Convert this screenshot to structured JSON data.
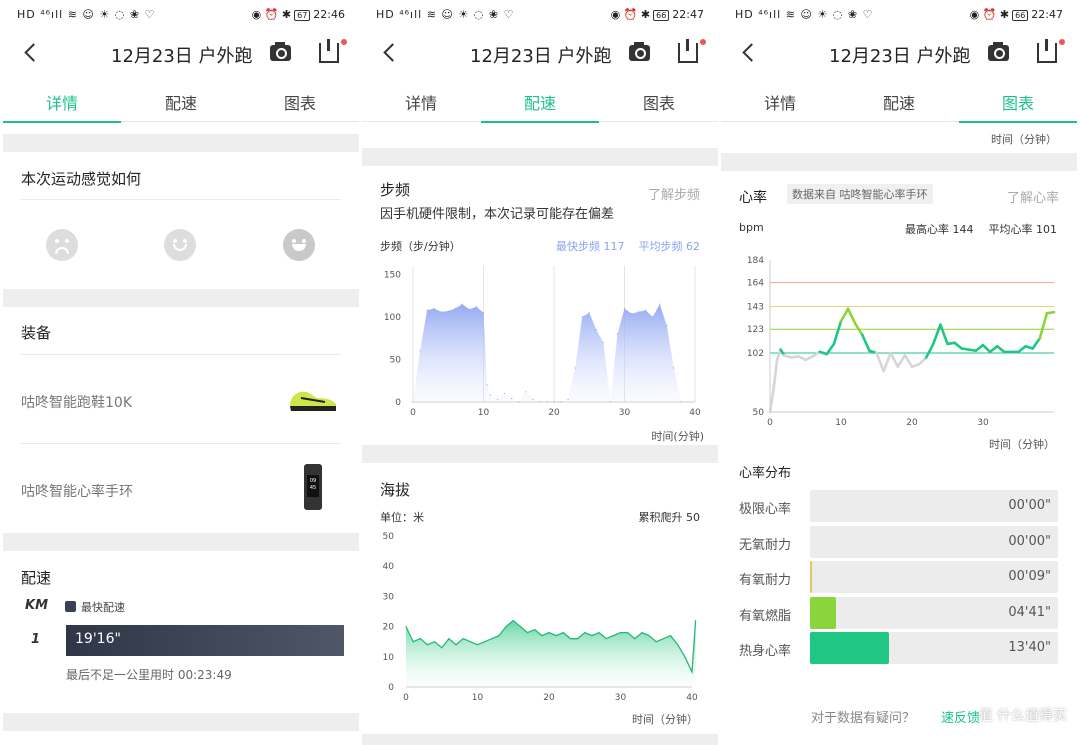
{
  "status": {
    "left_icons": "HD ⁴⁶ıll ≋ ☺ ☀ ◌ ❀ ♡",
    "right_icons": "◉ ⏰ ✱",
    "battery1": "67",
    "battery2": "66",
    "battery3": "66",
    "time1": "22:46",
    "time2": "22:47",
    "time3": "22:47"
  },
  "header": {
    "title": "12月23日 户外跑"
  },
  "tabs": [
    "详情",
    "配速",
    "图表"
  ],
  "detail": {
    "feel_title": "本次运动感觉如何",
    "equip_title": "装备",
    "shoe": "咕咚智能跑鞋10K",
    "band": "咕咚智能心率手环",
    "band_screen": "09 45",
    "pace_title": "配速",
    "km_label": "KM",
    "legend": "最快配速",
    "split_km": "1",
    "split_time": "19'16\"",
    "remainder": "最后不足一公里用时 00:23:49"
  },
  "pace": {
    "cadence_title": "步频",
    "learn_cadence": "了解步频",
    "cadence_note": "因手机硬件限制，本次记录可能存在偏差",
    "cadence_axis_label": "步频（步/分钟）",
    "fastest_cadence": "最快步频 117",
    "avg_cadence": "平均步频 62",
    "time_label": "时间(分钟)",
    "altitude_title": "海拔",
    "unit_label": "单位：米",
    "cum_climb": "累积爬升 50",
    "time_label2": "时间（分钟）"
  },
  "charts": {
    "top_time_label": "时间（分钟）",
    "hr_title": "心率",
    "hr_source": "数据来自 咕咚智能心率手环",
    "learn_hr": "了解心率",
    "bpm": "bpm",
    "max_hr": "最高心率 144",
    "avg_hr": "平均心率 101",
    "time_label": "时间（分钟）",
    "dist_title": "心率分布",
    "footer": "对于数据有疑问？",
    "footer_link": "速反馈",
    "watermark": "值 什么值得买"
  },
  "zones": [
    {
      "name": "极限心率",
      "time": "00'00\"",
      "fraction": 0,
      "color": "#e8c36a"
    },
    {
      "name": "无氧耐力",
      "time": "00'00\"",
      "fraction": 0,
      "color": "#e8c36a"
    },
    {
      "name": "有氧耐力",
      "time": "00'09\"",
      "fraction": 0.004,
      "color": "#e8c36a"
    },
    {
      "name": "有氧燃脂",
      "time": "04'41\"",
      "fraction": 0.12,
      "color": "#8ad43c"
    },
    {
      "name": "热身心率",
      "time": "13'40\"",
      "fraction": 0.36,
      "color": "#20c784"
    }
  ],
  "chart_data": [
    {
      "type": "area",
      "title": "步频",
      "ylabel": "步频（步/分钟）",
      "xlabel": "时间(分钟)",
      "xlim": [
        0,
        40
      ],
      "ylim": [
        0,
        160
      ],
      "xticks": [
        0,
        10,
        20,
        30,
        40
      ],
      "yticks": [
        0,
        50,
        100,
        150
      ],
      "x": [
        0,
        1,
        2,
        3,
        4,
        5,
        6,
        7,
        8,
        9,
        10,
        10.5,
        11,
        12,
        13,
        14,
        15,
        16,
        17,
        18,
        19,
        20,
        21,
        22,
        23,
        24,
        25,
        26,
        27,
        28,
        29,
        30,
        31,
        32,
        33,
        34,
        35,
        36,
        37,
        38
      ],
      "values": [
        0,
        60,
        108,
        110,
        106,
        107,
        110,
        115,
        109,
        112,
        105,
        20,
        8,
        3,
        10,
        4,
        0,
        12,
        3,
        0,
        0,
        0,
        0,
        3,
        40,
        100,
        105,
        85,
        70,
        0,
        80,
        110,
        104,
        106,
        108,
        100,
        115,
        90,
        40,
        0
      ]
    },
    {
      "type": "area",
      "title": "海拔",
      "ylabel": "单位：米",
      "xlabel": "时间（分钟）",
      "xlim": [
        0,
        40
      ],
      "ylim": [
        0,
        50
      ],
      "xticks": [
        0,
        10,
        20,
        30,
        40
      ],
      "yticks": [
        0,
        10,
        20,
        30,
        40,
        50
      ],
      "x": [
        0,
        1,
        2,
        3,
        4,
        5,
        6,
        7,
        8,
        9,
        10,
        11,
        12,
        13,
        14,
        15,
        16,
        17,
        18,
        19,
        20,
        21,
        22,
        23,
        24,
        25,
        26,
        27,
        28,
        29,
        30,
        31,
        32,
        33,
        34,
        35,
        36,
        37,
        38,
        39,
        40,
        40.5
      ],
      "values": [
        20,
        15,
        16,
        14,
        15,
        13,
        16,
        14,
        16,
        15,
        14,
        15,
        16,
        17,
        20,
        22,
        20,
        18,
        19,
        17,
        18,
        17,
        18,
        16,
        16,
        18,
        17,
        18,
        16,
        17,
        18,
        18,
        16,
        18,
        17,
        15,
        16,
        17,
        14,
        10,
        5,
        22
      ]
    },
    {
      "type": "line",
      "title": "心率",
      "ylabel": "bpm",
      "xlabel": "时间（分钟）",
      "xlim": [
        0,
        40
      ],
      "ylim": [
        50,
        184
      ],
      "xticks": [
        0,
        10,
        20,
        30
      ],
      "yticks": [
        50,
        102,
        123,
        143,
        164,
        184
      ],
      "x": [
        0,
        0.5,
        1,
        1.5,
        2,
        3,
        4,
        5,
        6,
        7,
        8,
        9,
        10,
        11,
        12,
        13,
        14,
        15,
        16,
        17,
        18,
        19,
        20,
        21,
        22,
        23,
        24,
        25,
        26,
        27,
        28,
        29,
        30,
        31,
        32,
        33,
        34,
        35,
        36,
        37,
        38,
        39,
        40
      ],
      "values": [
        50,
        70,
        96,
        105,
        100,
        98,
        99,
        96,
        99,
        103,
        101,
        110,
        130,
        141,
        128,
        118,
        104,
        102,
        86,
        102,
        90,
        100,
        90,
        92,
        98,
        110,
        127,
        110,
        111,
        106,
        105,
        104,
        109,
        103,
        108,
        103,
        103,
        103,
        108,
        106,
        115,
        137,
        138
      ]
    }
  ]
}
